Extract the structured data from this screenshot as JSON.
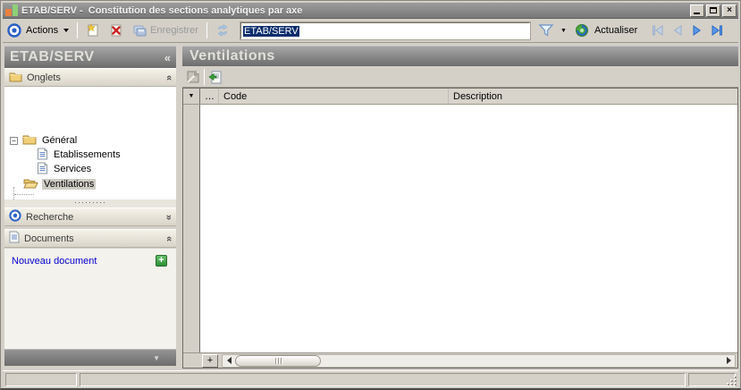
{
  "window": {
    "title": "ETAB/SERV -  Constitution des sections analytiques par axe"
  },
  "toolbar": {
    "actions_label": "Actions",
    "save_label": "Enregistrer",
    "record_field_value": "ETAB/SERV",
    "refresh_label": "Actualiser"
  },
  "sidebar": {
    "title": "ETAB/SERV",
    "onglets_label": "Onglets",
    "recherche_label": "Recherche",
    "documents_label": "Documents",
    "tree": {
      "general_label": "Général",
      "etablissements_label": "Etablissements",
      "services_label": "Services",
      "ventilations_label": "Ventilations"
    },
    "new_document_label": "Nouveau document"
  },
  "main": {
    "title": "Ventilations",
    "grid": {
      "columns": [
        "…",
        "Code",
        "Description"
      ],
      "rows": []
    }
  },
  "glyphs": {
    "panel_collapse": "«",
    "double_chevron": "«",
    "dropdown": "▼",
    "expander_expanded": "−",
    "splitter_dots": "·········",
    "plus": "+",
    "close": "×"
  },
  "colors": {
    "selection_navy": "#0b2d6b",
    "link_blue": "#0000cc",
    "accent_blue": "#2a64c8",
    "plus_green": "#3aa13a",
    "chrome_gray": "#d4d0c8"
  }
}
